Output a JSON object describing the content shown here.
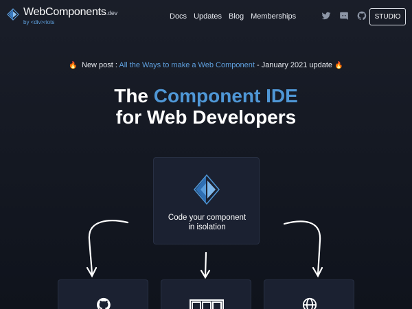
{
  "brand": {
    "name": "WebComponents",
    "tld": ".dev",
    "byline": "by <div>riots"
  },
  "nav": {
    "links": [
      "Docs",
      "Updates",
      "Blog",
      "Memberships"
    ],
    "icons": [
      "twitter-icon",
      "discord-icon",
      "github-icon"
    ],
    "studio_label": "STUDIO"
  },
  "announcement": {
    "prefix": "New post :",
    "link_text": "All the Ways to make a Web Component",
    "suffix": "- January 2021 update",
    "emoji": "🔥"
  },
  "hero": {
    "title_part1": "The",
    "title_accent": "Component IDE",
    "title_line2": "for Web Developers"
  },
  "main_card": {
    "line1": "Code your component",
    "line2": "in isolation",
    "icon": "webcomponents-logo-icon"
  },
  "feature_cards": [
    {
      "icon": "github-icon"
    },
    {
      "icon": "npm-icon"
    },
    {
      "icon": "globe-icon"
    }
  ],
  "colors": {
    "background": "#12161f",
    "accent": "#4f97d6",
    "card": "#1b2131"
  }
}
